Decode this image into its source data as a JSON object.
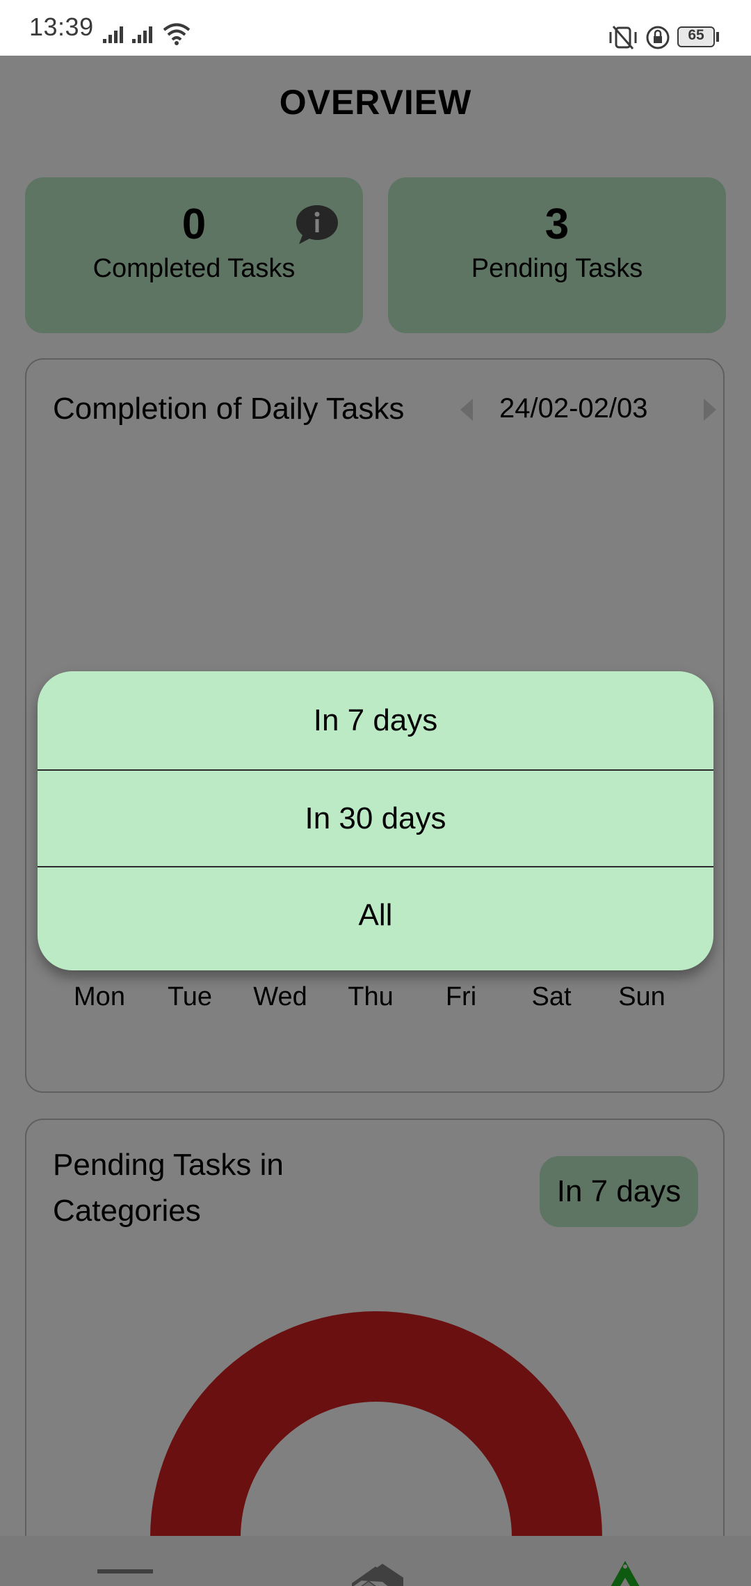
{
  "status_bar": {
    "time": "13:39",
    "battery": "65"
  },
  "header": {
    "title": "OVERVIEW"
  },
  "stats": {
    "completed": {
      "value": "0",
      "label": "Completed Tasks"
    },
    "pending": {
      "value": "3",
      "label": "Pending Tasks"
    }
  },
  "daily_panel": {
    "title": "Completion of Daily Tasks",
    "date_range": "24/02-02/03",
    "days": [
      "Mon",
      "Tue",
      "Wed",
      "Thu",
      "Fri",
      "Sat",
      "Sun"
    ]
  },
  "dropdown": {
    "options": [
      "In 7 days",
      "In 30 days",
      "All"
    ]
  },
  "pending_panel": {
    "title": "Pending Tasks in Categories",
    "range_badge": "In 7 days",
    "donut_color": "#6b1010"
  },
  "bottom_nav": {
    "items": [
      "menu-icon",
      "home-icon",
      "logo-triangle-icon"
    ],
    "accent": "#0e5a10"
  }
}
